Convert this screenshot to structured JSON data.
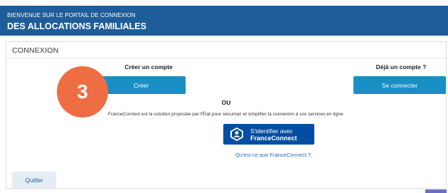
{
  "header": {
    "line1": "BIENVENUE SUR LE PORTAIL DE CONNEXION",
    "line2": "DES ALLOCATIONS FAMILIALES",
    "color": "#1f5d9a"
  },
  "panel": {
    "title": "CONNEXION"
  },
  "create": {
    "label": "Créer un compte",
    "button": "Créer"
  },
  "existing": {
    "label": "Déjà un compte ?",
    "button": "Se connecter"
  },
  "separator": "OU",
  "franceconnect": {
    "description": "FranceConnect est la solution proposée par l'État pour sécuriser et simplifier la connexion à vos services en ligne.",
    "button_line1": "S'identifier avec",
    "button_line2": "FranceConnect",
    "link": "Qu'est-ce que FranceConnect ?",
    "icon": "franceconnect-logo-icon"
  },
  "quit_button": "Quitter",
  "annotation": {
    "step_number": "3",
    "color": "#ef6d43"
  },
  "colors": {
    "primary_button": "#1a8fc4",
    "franceconnect_blue": "#034ea2",
    "link": "#1a6fb5"
  }
}
